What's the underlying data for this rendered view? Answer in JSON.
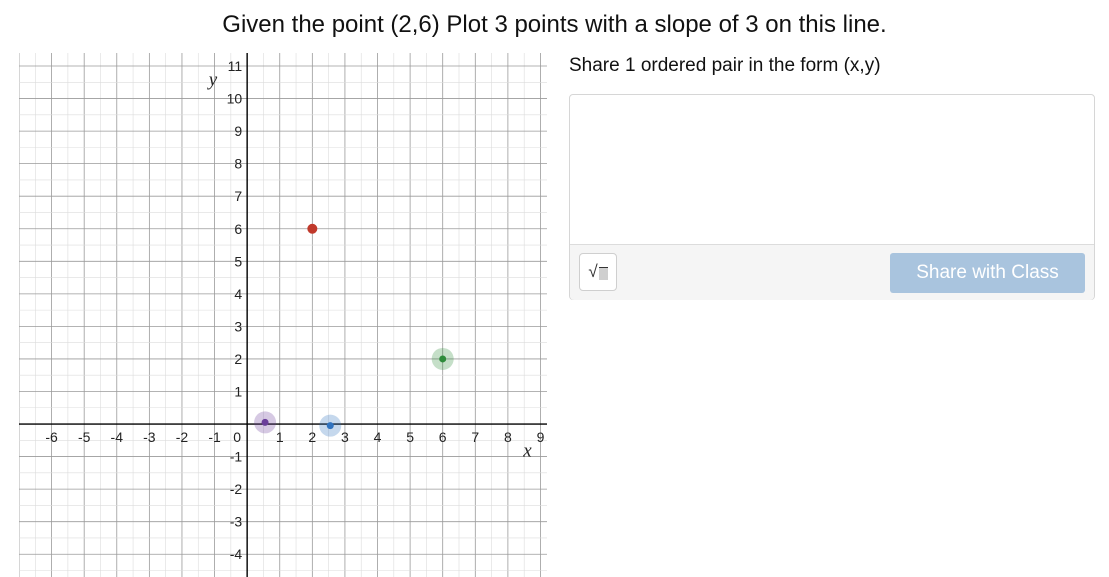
{
  "question": {
    "title": "Given the point (2,6) Plot 3 points with a slope of 3 on this line."
  },
  "graph": {
    "axis_labels": {
      "x": "x",
      "y": "y"
    },
    "x_range": [
      -7.0,
      9.2
    ],
    "y_range": [
      -4.7,
      11.4
    ],
    "x_ticks": [
      "-6",
      "-5",
      "-4",
      "-3",
      "-2",
      "-1",
      "0",
      "1",
      "2",
      "3",
      "4",
      "5",
      "6",
      "7",
      "8",
      "9"
    ],
    "y_ticks": [
      "-4",
      "-3",
      "-2",
      "-1",
      "1",
      "2",
      "3",
      "4",
      "5",
      "6",
      "7",
      "8",
      "9",
      "10",
      "11"
    ],
    "points": [
      {
        "name": "given-point",
        "x": 2,
        "y": 6,
        "color": "#c0392b",
        "halo": false
      },
      {
        "name": "green-point",
        "x": 6,
        "y": 2,
        "color": "#2e8b3a",
        "halo": true
      },
      {
        "name": "purple-point",
        "x": 0.55,
        "y": 0.05,
        "color": "#6a3d9a",
        "halo": true
      },
      {
        "name": "blue-point",
        "x": 2.55,
        "y": -0.05,
        "color": "#2f73c0",
        "halo": true
      }
    ]
  },
  "response": {
    "prompt": "Share 1 ordered pair in the form (x,y)",
    "input_value": "",
    "math_button_label": "√",
    "share_button_label": "Share with Class",
    "share_button_color": "#a9c4de"
  }
}
